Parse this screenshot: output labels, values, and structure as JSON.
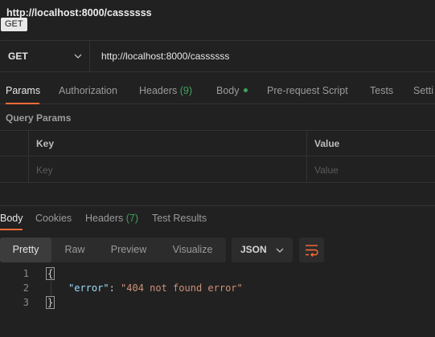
{
  "request": {
    "title": "http://localhost:8000/cassssss",
    "method_tag": "GET",
    "method": "GET",
    "url": "http://localhost:8000/cassssss"
  },
  "request_tabs": [
    {
      "label": "Params",
      "count": "",
      "active": true
    },
    {
      "label": "Authorization",
      "count": "",
      "active": false
    },
    {
      "label": "Headers",
      "count": "(9)",
      "active": false
    },
    {
      "label": "Body",
      "count": "",
      "dot": true,
      "active": false
    },
    {
      "label": "Pre-request Script",
      "count": "",
      "active": false
    },
    {
      "label": "Tests",
      "count": "",
      "active": false
    },
    {
      "label": "Setti",
      "count": "",
      "active": false
    }
  ],
  "query_params": {
    "section_label": "Query Params",
    "columns": [
      "Key",
      "Value"
    ],
    "placeholders": {
      "key": "Key",
      "value": "Value"
    }
  },
  "response_tabs": [
    {
      "label": "Body",
      "count": "",
      "active": true
    },
    {
      "label": "Cookies",
      "count": "",
      "active": false
    },
    {
      "label": "Headers",
      "count": "(7)",
      "active": false
    },
    {
      "label": "Test Results",
      "count": "",
      "active": false
    }
  ],
  "view_modes": [
    {
      "label": "Pretty",
      "active": true
    },
    {
      "label": "Raw",
      "active": false
    },
    {
      "label": "Preview",
      "active": false
    },
    {
      "label": "Visualize",
      "active": false
    }
  ],
  "format": "JSON",
  "response_body": {
    "line_numbers": [
      "1",
      "2",
      "3"
    ],
    "open_brace": "{",
    "key": "\"error\"",
    "colon": ": ",
    "value": "\"404 not found error\"",
    "close_brace": "}"
  },
  "colors": {
    "background": "#212121",
    "accent": "#ff6c37",
    "success": "#3ea45b"
  },
  "icons": {
    "method_dropdown": "chevron-down-icon",
    "format_dropdown": "chevron-down-icon",
    "wrap": "wrap-lines-icon"
  }
}
